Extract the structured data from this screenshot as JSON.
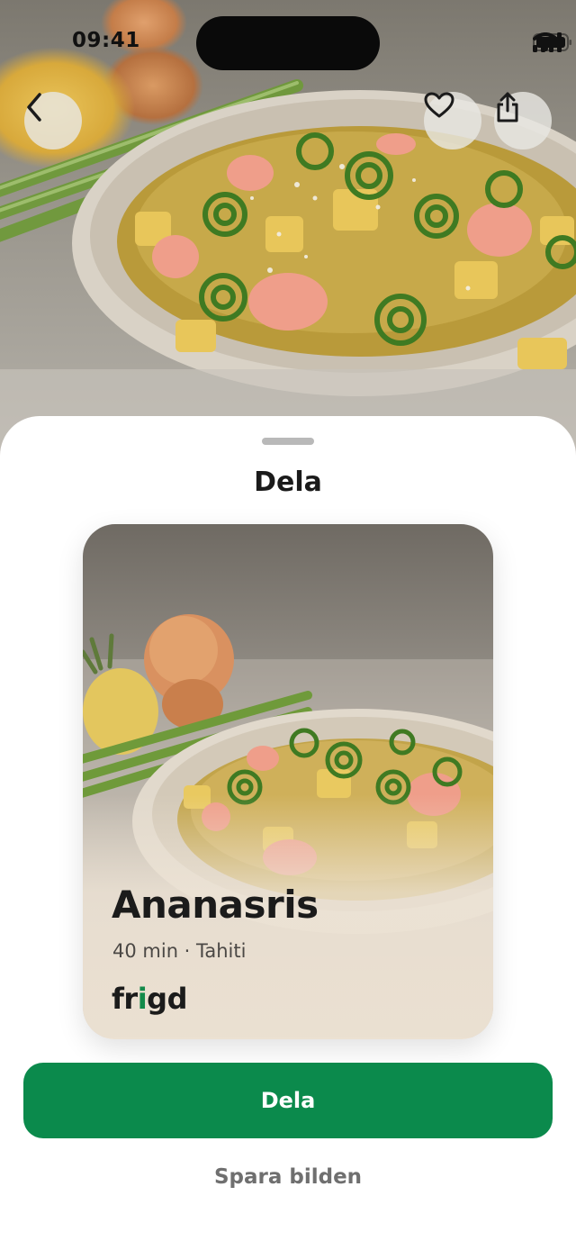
{
  "status_bar": {
    "time": "09:41"
  },
  "hero": {
    "image_desc_icon": "recipe-photo"
  },
  "nav": {
    "back_icon": "chevron-left-icon",
    "favorite_icon": "heart-icon",
    "share_icon": "share-icon"
  },
  "sheet": {
    "title": "Dela",
    "card": {
      "title": "Ananasris",
      "meta": "40 min · Tahiti",
      "logo_prefix": "fr",
      "logo_accent": "i",
      "logo_suffix": "gd"
    },
    "primary_button": "Dela",
    "secondary_button": "Spara bilden"
  },
  "colors": {
    "brand_green": "#0b8a4c",
    "logo_accent": "#138a4a"
  }
}
